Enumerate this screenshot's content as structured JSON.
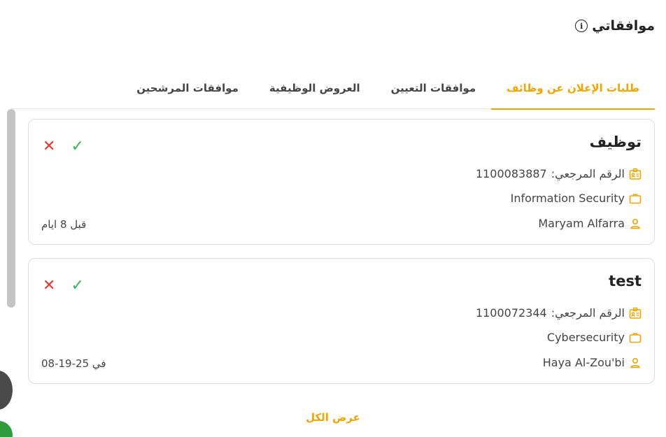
{
  "header": {
    "title": "موافقاتي",
    "info_icon": "i"
  },
  "tabs": [
    {
      "label": "طلبات الإعلان عن وظائف",
      "active": true
    },
    {
      "label": "موافقات التعيين",
      "active": false
    },
    {
      "label": "العروض الوظيفية",
      "active": false
    },
    {
      "label": "موافقات المرشحين",
      "active": false
    }
  ],
  "cards": [
    {
      "title": "توظيف",
      "ref_label": "الرقم المرجعي:",
      "ref_value": "1100083887",
      "department": "Information Security",
      "person": "Maryam Alfarra",
      "time": "قبل 8 ايام",
      "reject_symbol": "✕",
      "approve_symbol": "✓"
    },
    {
      "title": "test",
      "ref_label": "الرقم المرجعي:",
      "ref_value": "1100072344",
      "department": "Cybersecurity",
      "person": "Haya Al-Zou'bi",
      "time": "في 25-19-08",
      "reject_symbol": "✕",
      "approve_symbol": "✓"
    }
  ],
  "view_all": "عرض الكل",
  "colors": {
    "accent": "#f0a500",
    "reject": "#e53935",
    "approve": "#34b35a"
  }
}
